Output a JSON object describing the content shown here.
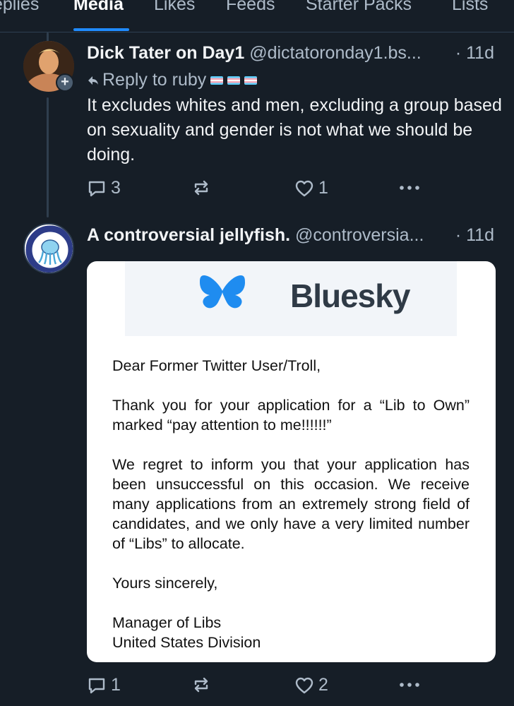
{
  "tabs": [
    "eplies",
    "Media",
    "Likes",
    "Feeds",
    "Starter Packs",
    "Lists"
  ],
  "active_tab": "Media",
  "post1": {
    "author_name": "Dick Tater on Day1",
    "author_handle": "@dictatoronday1.bs...",
    "time": "· 11d",
    "reply_to_label": "Reply to ruby",
    "text": "It excludes whites and men, excluding a group based on sexuality and gender is not what we should be doing.",
    "replies": "3",
    "reposts": "",
    "likes": "1"
  },
  "post2": {
    "author_name": "A controversial jellyfish.",
    "author_handle": "@controversia...",
    "time": "· 11d",
    "avatar_text_top": "STAY WOKE",
    "avatar_text_bottom": "STAY BUOYANT",
    "replies": "1",
    "reposts": "",
    "likes": "2",
    "image": {
      "brand": "Bluesky",
      "greeting": "Dear Former Twitter User/Troll,",
      "para1": "Thank you for your application for a “Lib to Own” marked “pay attention to me!!!!!!”",
      "para2": "We regret to inform you that your application has been unsuccessful on this occasion. We receive many applications from an extremely strong field of candidates, and we only have a very limited number of “Libs” to allocate.",
      "closing": "Yours sincerely,",
      "signature_line1": "Manager of Libs",
      "signature_line2": "United States Division"
    }
  },
  "colors": {
    "background": "#161e27",
    "accent": "#208bfe",
    "muted_text": "#aebbc9"
  }
}
